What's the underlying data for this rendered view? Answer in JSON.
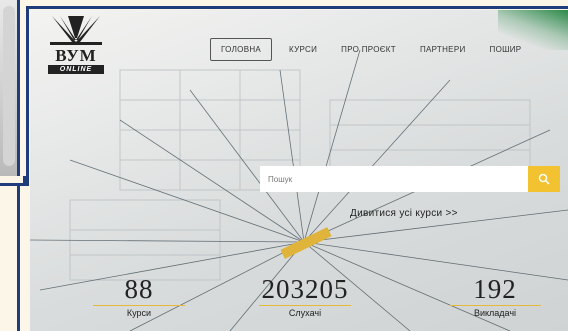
{
  "logo": {
    "title": "ВУМ",
    "subtitle": "ONLINE"
  },
  "nav": {
    "items": [
      {
        "label": "ГОЛОВНА",
        "active": true
      },
      {
        "label": "КУРСИ",
        "active": false
      },
      {
        "label": "ПРО ПРОЄКТ",
        "active": false
      },
      {
        "label": "ПАРТНЕРИ",
        "active": false
      },
      {
        "label": "ПОШИР",
        "active": false
      }
    ]
  },
  "search": {
    "placeholder": "Пошук",
    "value": ""
  },
  "links": {
    "all_courses": "Дивитися усі курси >>"
  },
  "stats": [
    {
      "value": "88",
      "label": "Курси"
    },
    {
      "value": "203205",
      "label": "Слухачі"
    },
    {
      "value": "192",
      "label": "Викладачі"
    }
  ],
  "colors": {
    "accent": "#f2c230",
    "frame": "#1f3d7a",
    "background": "#fbf6e7"
  },
  "icons": {
    "search_button": "search-icon",
    "logo": "book-logo-icon"
  }
}
